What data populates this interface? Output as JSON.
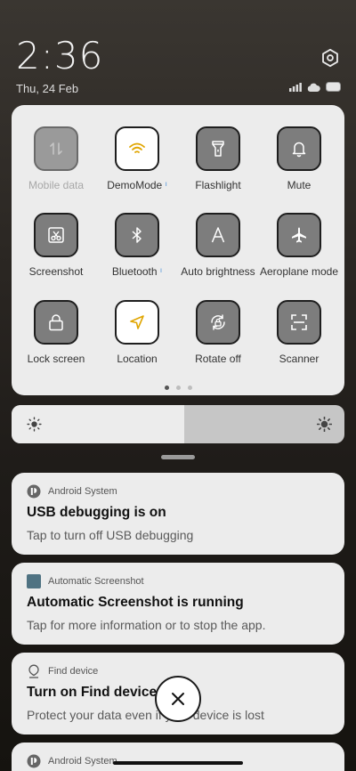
{
  "status": {
    "time": "2:36",
    "date": "Thu, 24 Feb"
  },
  "icons": {
    "settings": "gear-icon",
    "signal": "signal-icon",
    "cloud": "cloud-icon",
    "battery": "battery-icon"
  },
  "quick_settings": {
    "tiles": [
      {
        "label": "Mobile data",
        "icon": "mobile-data-icon",
        "state": "disabled"
      },
      {
        "label": "DemoMode",
        "icon": "wifi-icon",
        "state": "on"
      },
      {
        "label": "Flashlight",
        "icon": "flashlight-icon",
        "state": "off"
      },
      {
        "label": "Mute",
        "icon": "bell-icon",
        "state": "off"
      },
      {
        "label": "Screenshot",
        "icon": "scissors-icon",
        "state": "off"
      },
      {
        "label": "Bluetooth",
        "icon": "bluetooth-icon",
        "state": "off"
      },
      {
        "label": "Auto brightness",
        "icon": "auto-brightness-icon",
        "state": "off"
      },
      {
        "label": "Aeroplane mode",
        "icon": "airplane-icon",
        "state": "off"
      },
      {
        "label": "Lock screen",
        "icon": "lock-icon",
        "state": "off"
      },
      {
        "label": "Location",
        "icon": "location-icon",
        "state": "on"
      },
      {
        "label": "Rotate off",
        "icon": "rotate-icon",
        "state": "off"
      },
      {
        "label": "Scanner",
        "icon": "scanner-icon",
        "state": "off"
      }
    ],
    "page_indicator": {
      "pages": 3,
      "current": 1
    }
  },
  "brightness": {
    "level": 0.52
  },
  "notifications": [
    {
      "app": "Android System",
      "title": "USB debugging is on",
      "body": "Tap to turn off USB debugging"
    },
    {
      "app": "Automatic Screenshot",
      "title": "Automatic Screenshot is running",
      "body": "Tap for more information or to stop the app."
    },
    {
      "app": "Find device",
      "title": "Turn on Find device",
      "body": "Protect your data even if your device is lost"
    },
    {
      "app": "Android System"
    }
  ],
  "colors": {
    "panel": "#ececec",
    "tile_off": "#7d7d7d",
    "tile_on": "#ffffff",
    "accent_yellow": "#e0a500"
  }
}
